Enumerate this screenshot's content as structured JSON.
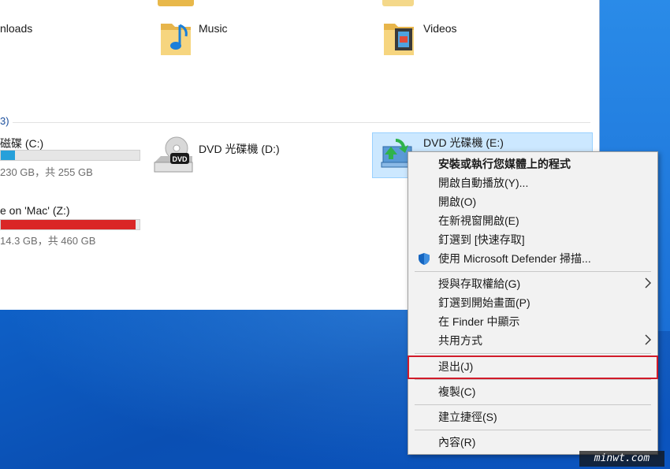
{
  "folders": {
    "downloads_label": "nloads",
    "music_label": "Music",
    "videos_label": "Videos"
  },
  "group": {
    "header": "3)"
  },
  "drives": {
    "c": {
      "name": "磁碟 (C:)",
      "space": "230 GB，共 255 GB",
      "fill_pct": 10,
      "bar_color": "#26a0da"
    },
    "d": {
      "name": "DVD 光碟機 (D:)"
    },
    "e": {
      "name": "DVD 光碟機 (E:)"
    },
    "z": {
      "name": "e on 'Mac' (Z:)",
      "space": "14.3 GB，共 460 GB",
      "fill_pct": 97,
      "bar_color": "#da2626"
    }
  },
  "context_menu": {
    "items": [
      {
        "label": "安裝或執行您媒體上的程式",
        "bold": true
      },
      {
        "label": "開啟自動播放(Y)..."
      },
      {
        "label": "開啟(O)"
      },
      {
        "label": "在新視窗開啟(E)"
      },
      {
        "label": "釘選到 [快速存取]"
      },
      {
        "label": "使用 Microsoft Defender 掃描...",
        "icon": "shield-icon"
      },
      {
        "label": "授與存取權給(G)",
        "submenu": true
      },
      {
        "label": "釘選到開始畫面(P)"
      },
      {
        "label": "在 Finder 中顯示"
      },
      {
        "label": "共用方式",
        "submenu": true
      },
      {
        "label": "退出(J)",
        "highlighted": true
      },
      {
        "label": "複製(C)"
      },
      {
        "label": "建立捷徑(S)"
      },
      {
        "label": "內容(R)"
      }
    ]
  },
  "watermark": "minwt.com",
  "colors": {
    "highlight_border": "#d11b2a",
    "selection_bg": "#cce8ff"
  }
}
